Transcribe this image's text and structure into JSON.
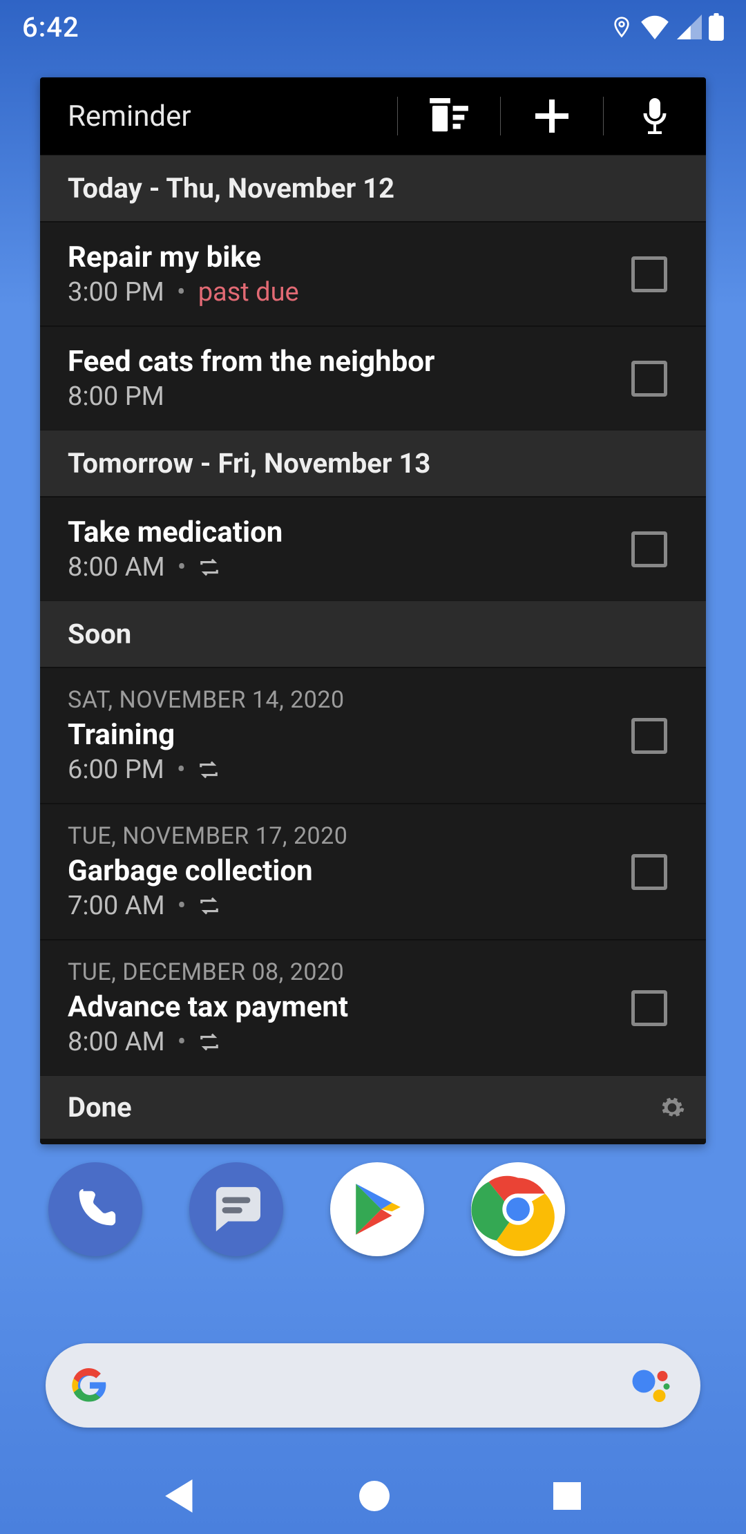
{
  "status": {
    "time": "6:42"
  },
  "widget": {
    "title": "Reminder",
    "sections": {
      "today": "Today - Thu, November 12",
      "tomorrow": "Tomorrow - Fri, November 13",
      "soon": "Soon",
      "done": "Done"
    },
    "items": [
      {
        "title": "Repair my bike",
        "time": "3:00 PM",
        "status": "past due"
      },
      {
        "title": "Feed cats from the neighbor",
        "time": "8:00 PM"
      },
      {
        "title": "Take medication",
        "time": "8:00 AM"
      },
      {
        "date": "SAT, NOVEMBER 14, 2020",
        "title": "Training",
        "time": "6:00 PM"
      },
      {
        "date": "TUE, NOVEMBER 17, 2020",
        "title": "Garbage collection",
        "time": "7:00 AM"
      },
      {
        "date": "TUE, DECEMBER 08, 2020",
        "title": "Advance tax payment",
        "time": "8:00 AM"
      }
    ]
  },
  "dock": [
    "phone",
    "messages",
    "play-store",
    "chrome"
  ]
}
